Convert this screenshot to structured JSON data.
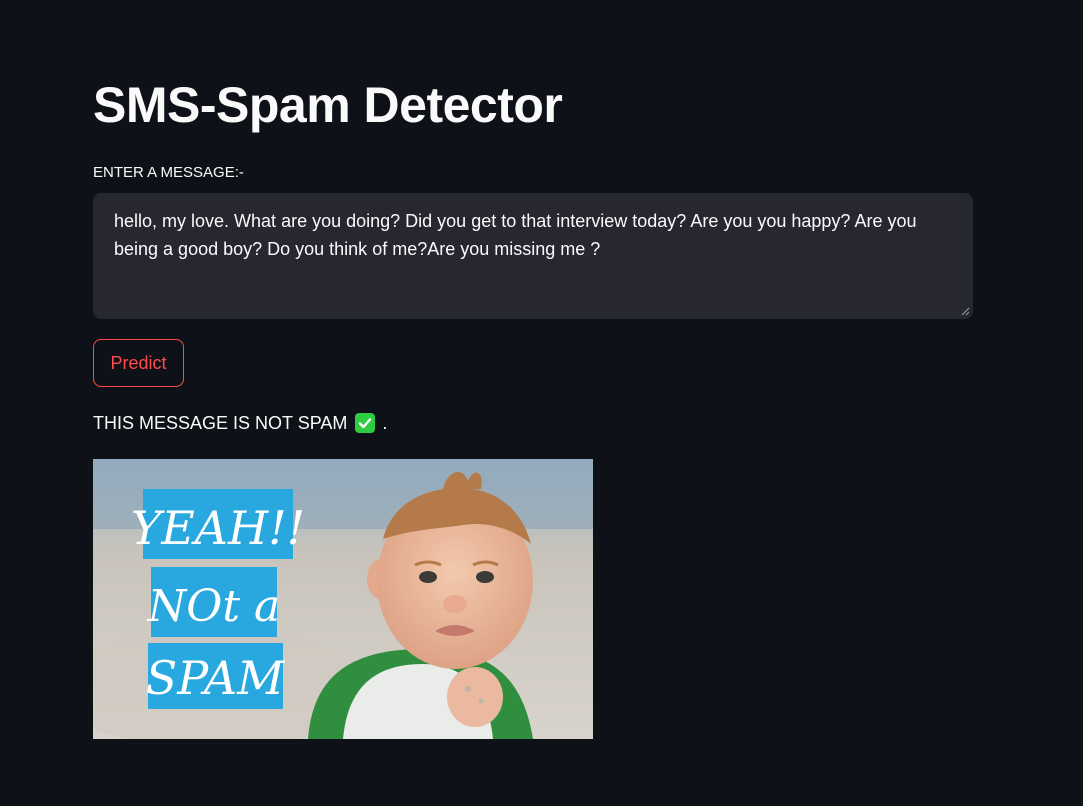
{
  "page": {
    "title": "SMS-Spam Detector"
  },
  "input": {
    "label": "ENTER A MESSAGE:-",
    "value": "hello, my love. What are you doing? Did you get to that interview today? Are you you happy? Are you being a good boy? Do you think of me?Are you missing me ?"
  },
  "predict_button": {
    "label": "Predict"
  },
  "result": {
    "text": "THIS MESSAGE IS NOT SPAM",
    "icon": "check-mark-icon",
    "suffix": "."
  },
  "image": {
    "caption_lines": [
      "YEAH!!",
      "NOt a",
      "SPAM"
    ]
  },
  "colors": {
    "background": "#0e1117",
    "text": "#fafafa",
    "input_bg": "#262730",
    "accent": "#ff4b4b",
    "check": "#2ecc40",
    "caption_bg": "#29a8e0"
  }
}
